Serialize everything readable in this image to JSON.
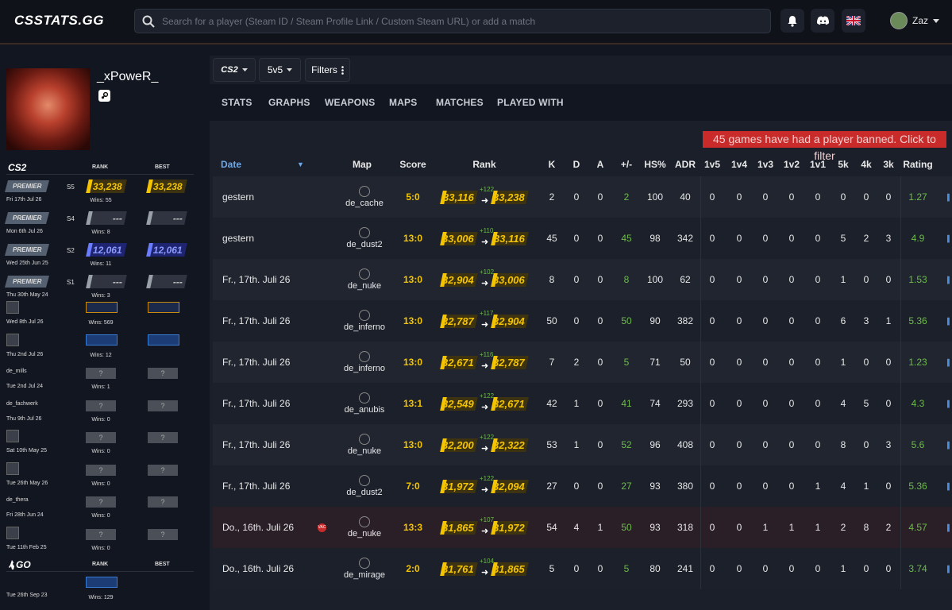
{
  "brand": {
    "logo": "CSSTATS.GG"
  },
  "search": {
    "placeholder": "Search for a player (Steam ID / Steam Profile Link / Custom Steam URL) or add a match"
  },
  "user": {
    "name": "Zaz"
  },
  "profile": {
    "name": "_xPoweR_"
  },
  "sidebar": {
    "cs2": {
      "logo": "CS2",
      "rank_header": "RANK",
      "best_header": "BEST"
    },
    "go": {
      "logo": "GO",
      "rank_header": "RANK",
      "best_header": "BEST"
    },
    "premier_rows": [
      {
        "label": "PREMIER",
        "season": "S5",
        "date": "Fri 17th Jul 26",
        "wins": "Wins: 55",
        "rank": "33,238",
        "best": "33,238",
        "tier": "gold",
        "best_tier": "gold"
      },
      {
        "label": "PREMIER",
        "season": "S4",
        "date": "Mon 6th Jul 26",
        "wins": "Wins: 8",
        "rank": "---",
        "best": "---",
        "tier": "grey",
        "best_tier": "grey"
      },
      {
        "label": "PREMIER",
        "season": "S2",
        "date": "Wed 25th Jun 25",
        "wins": "Wins: 11",
        "rank": "12,061",
        "best": "12,061",
        "tier": "blue",
        "best_tier": "blue"
      },
      {
        "label": "PREMIER",
        "season": "S1",
        "date": "Thu 30th May 24",
        "wins": "Wins: 3",
        "rank": "---",
        "best": "---",
        "tier": "grey",
        "best_tier": "grey"
      }
    ],
    "competitive_rows": [
      {
        "map": "",
        "date": "Wed 8th Jul 26",
        "wins": "Wins: 569",
        "kind": "faceit"
      },
      {
        "map": "",
        "date": "Thu 2nd Jul 26",
        "wins": "Wins: 12",
        "kind": "faceit-blue"
      },
      {
        "map": "de_mills",
        "date": "Tue 2nd Jul 24",
        "wins": "Wins: 1",
        "kind": "unknown"
      },
      {
        "map": "de_fachwerk",
        "date": "Thu 9th Jul 26",
        "wins": "Wins: 0",
        "kind": "unknown"
      },
      {
        "map": "",
        "date": "Sat 10th May 25",
        "wins": "Wins: 0",
        "kind": "unknown"
      },
      {
        "map": "",
        "date": "Tue 26th May 26",
        "wins": "Wins: 0",
        "kind": "unknown"
      },
      {
        "map": "de_thera",
        "date": "Fri 28th Jun 24",
        "wins": "Wins: 0",
        "kind": "unknown"
      },
      {
        "map": "",
        "date": "Tue 11th Feb 25",
        "wins": "Wins: 0",
        "kind": "unknown"
      }
    ],
    "go_row": {
      "date": "Tue 26th Sep 23",
      "wins": "Wins: 129"
    },
    "unknown_mark": "?"
  },
  "controls": {
    "game": "CS2",
    "mode": "5v5",
    "filters": "Filters"
  },
  "tabs": [
    "STATS",
    "GRAPHS",
    "WEAPONS",
    "MAPS",
    "MATCHES",
    "PLAYED WITH"
  ],
  "banner": "45 games have had a player banned. Click to filter",
  "columns": [
    "Date",
    "Map",
    "Score",
    "Rank",
    "K",
    "D",
    "A",
    "+/-",
    "HS%",
    "ADR",
    "1v5",
    "1v4",
    "1v3",
    "1v2",
    "1v1",
    "5k",
    "4k",
    "3k",
    "Rating"
  ],
  "rows": [
    {
      "date": "gestern",
      "map": "de_cache",
      "score": "5:0",
      "rank_from": "33,116",
      "delta": "+122",
      "rank_to": "33,238",
      "k": "2",
      "d": "0",
      "a": "0",
      "pm": "2",
      "hs": "100",
      "adr": "40",
      "c15": "0",
      "c14": "0",
      "c13": "0",
      "c12": "0",
      "c11": "0",
      "k5": "0",
      "k4": "0",
      "k3": "0",
      "rating": "1.27",
      "vac": false
    },
    {
      "date": "gestern",
      "map": "de_dust2",
      "score": "13:0",
      "rank_from": "33,006",
      "delta": "+110",
      "rank_to": "33,116",
      "k": "45",
      "d": "0",
      "a": "0",
      "pm": "45",
      "hs": "98",
      "adr": "342",
      "c15": "0",
      "c14": "0",
      "c13": "0",
      "c12": "0",
      "c11": "0",
      "k5": "5",
      "k4": "2",
      "k3": "3",
      "rating": "4.9",
      "vac": false
    },
    {
      "date": "Fr., 17th. Juli 26",
      "map": "de_nuke",
      "score": "13:0",
      "rank_from": "32,904",
      "delta": "+102",
      "rank_to": "33,006",
      "k": "8",
      "d": "0",
      "a": "0",
      "pm": "8",
      "hs": "100",
      "adr": "62",
      "c15": "0",
      "c14": "0",
      "c13": "0",
      "c12": "0",
      "c11": "0",
      "k5": "1",
      "k4": "0",
      "k3": "0",
      "rating": "1.53",
      "vac": false
    },
    {
      "date": "Fr., 17th. Juli 26",
      "map": "de_inferno",
      "score": "13:0",
      "rank_from": "32,787",
      "delta": "+117",
      "rank_to": "32,904",
      "k": "50",
      "d": "0",
      "a": "0",
      "pm": "50",
      "hs": "90",
      "adr": "382",
      "c15": "0",
      "c14": "0",
      "c13": "0",
      "c12": "0",
      "c11": "0",
      "k5": "6",
      "k4": "3",
      "k3": "1",
      "rating": "5.36",
      "vac": false
    },
    {
      "date": "Fr., 17th. Juli 26",
      "map": "de_inferno",
      "score": "13:0",
      "rank_from": "32,671",
      "delta": "+116",
      "rank_to": "32,787",
      "k": "7",
      "d": "2",
      "a": "0",
      "pm": "5",
      "hs": "71",
      "adr": "50",
      "c15": "0",
      "c14": "0",
      "c13": "0",
      "c12": "0",
      "c11": "0",
      "k5": "1",
      "k4": "0",
      "k3": "0",
      "rating": "1.23",
      "vac": false
    },
    {
      "date": "Fr., 17th. Juli 26",
      "map": "de_anubis",
      "score": "13:1",
      "rank_from": "32,549",
      "delta": "+122",
      "rank_to": "32,671",
      "k": "42",
      "d": "1",
      "a": "0",
      "pm": "41",
      "hs": "74",
      "adr": "293",
      "c15": "0",
      "c14": "0",
      "c13": "0",
      "c12": "0",
      "c11": "0",
      "k5": "4",
      "k4": "5",
      "k3": "0",
      "rating": "4.3",
      "vac": false
    },
    {
      "date": "Fr., 17th. Juli 26",
      "map": "de_nuke",
      "score": "13:0",
      "rank_from": "32,200",
      "delta": "+122",
      "rank_to": "32,322",
      "k": "53",
      "d": "1",
      "a": "0",
      "pm": "52",
      "hs": "96",
      "adr": "408",
      "c15": "0",
      "c14": "0",
      "c13": "0",
      "c12": "0",
      "c11": "0",
      "k5": "8",
      "k4": "0",
      "k3": "3",
      "rating": "5.6",
      "vac": false
    },
    {
      "date": "Fr., 17th. Juli 26",
      "map": "de_dust2",
      "score": "7:0",
      "rank_from": "31,972",
      "delta": "+122",
      "rank_to": "32,094",
      "k": "27",
      "d": "0",
      "a": "0",
      "pm": "27",
      "hs": "93",
      "adr": "380",
      "c15": "0",
      "c14": "0",
      "c13": "0",
      "c12": "0",
      "c11": "1",
      "k5": "4",
      "k4": "1",
      "k3": "0",
      "rating": "5.36",
      "vac": false
    },
    {
      "date": "Do., 16th. Juli 26",
      "map": "de_nuke",
      "score": "13:3",
      "rank_from": "31,865",
      "delta": "+107",
      "rank_to": "31,972",
      "k": "54",
      "d": "4",
      "a": "1",
      "pm": "50",
      "hs": "93",
      "adr": "318",
      "c15": "0",
      "c14": "0",
      "c13": "1",
      "c12": "1",
      "c11": "1",
      "k5": "2",
      "k4": "8",
      "k3": "2",
      "rating": "4.57",
      "vac": true
    },
    {
      "date": "Do., 16th. Juli 26",
      "map": "de_mirage",
      "score": "2:0",
      "rank_from": "31,761",
      "delta": "+104",
      "rank_to": "31,865",
      "k": "5",
      "d": "0",
      "a": "0",
      "pm": "5",
      "hs": "80",
      "adr": "241",
      "c15": "0",
      "c14": "0",
      "c13": "0",
      "c12": "0",
      "c11": "0",
      "k5": "1",
      "k4": "0",
      "k3": "0",
      "rating": "3.74",
      "vac": false
    }
  ],
  "vac_label": "VAC",
  "colors": {
    "accent": "#f5c400",
    "positive": "#6dbb4a",
    "banner": "#c92a2a",
    "link": "#4a8ee0"
  }
}
